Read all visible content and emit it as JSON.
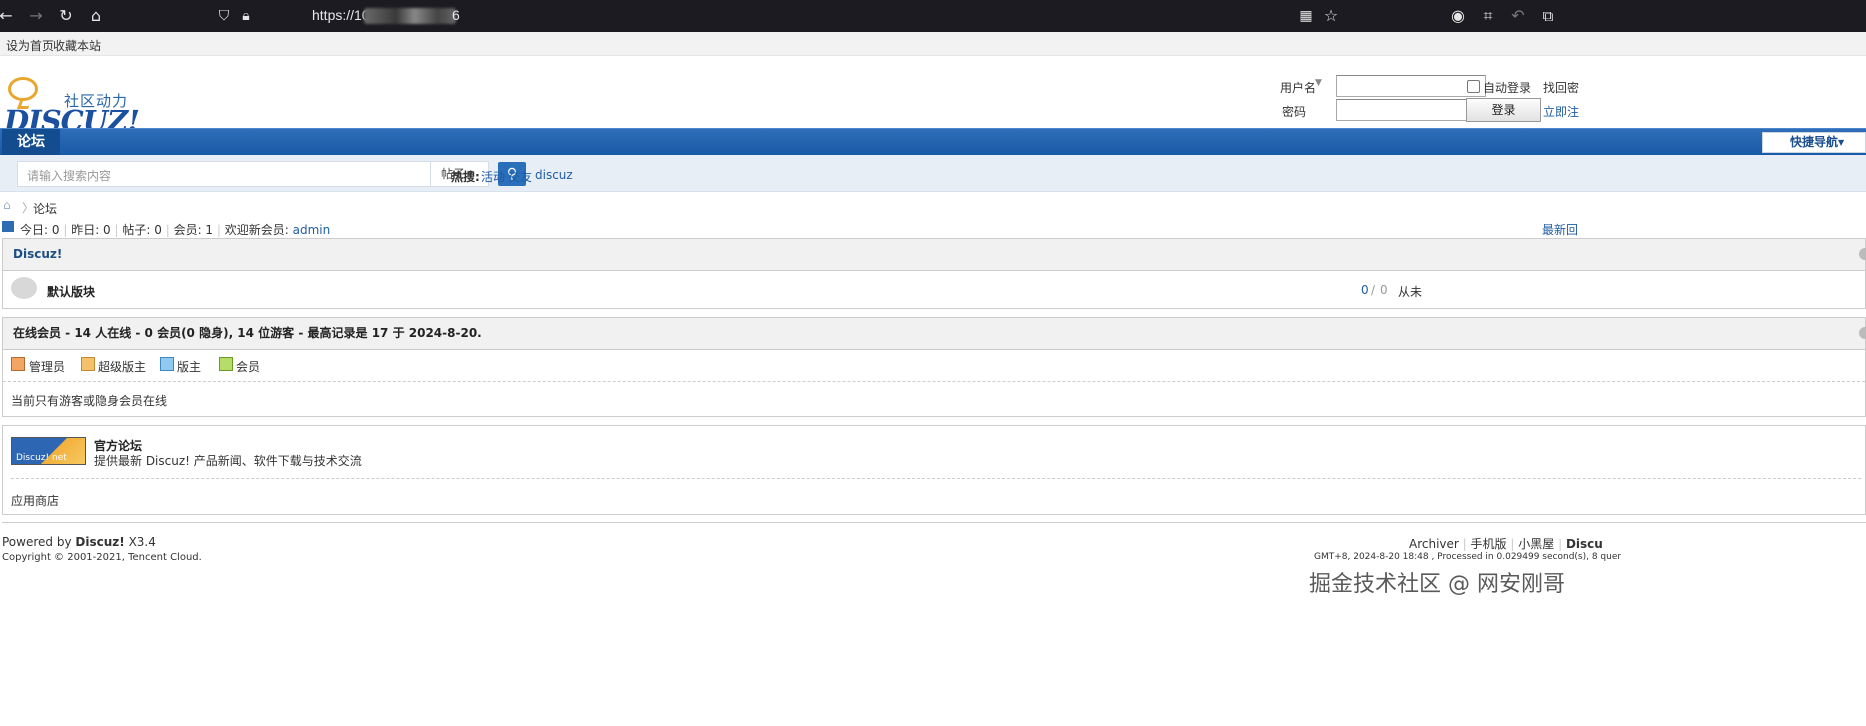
{
  "browser": {
    "url_prefix": "https://101",
    "url_suffix": "6",
    "icons": [
      "back-icon",
      "forward-icon",
      "reload-icon",
      "home-icon",
      "shield-icon",
      "lock-icon",
      "qr-icon",
      "star-icon",
      "account-icon",
      "crop-icon",
      "undo-icon",
      "extensions-icon"
    ]
  },
  "topnav": {
    "set_home": "设为首页",
    "bookmark": "收藏本站"
  },
  "logo": {
    "sub": "社区动力",
    "main": "DISCUZ!"
  },
  "login": {
    "username_label": "用户名",
    "password_label": "密码",
    "auto_login": "自动登录",
    "find_password": "找回密",
    "register": "立即注",
    "login_button": "登录"
  },
  "nav": {
    "forum_tab": "论坛",
    "quick_nav": "快捷导航"
  },
  "search": {
    "placeholder": "请输入搜索内容",
    "type": "帖子",
    "hot_label": "热搜:",
    "hot_terms": [
      "活动",
      "交友",
      "discuz"
    ]
  },
  "breadcrumb": {
    "current": "论坛"
  },
  "stats": {
    "today": "今日: 0",
    "yesterday": "昨日: 0",
    "posts": "帖子: 0",
    "members": "会员: 1",
    "welcome": "欢迎新会员:",
    "new_member": "admin",
    "latest": "最新回"
  },
  "forum_category": {
    "title": "Discuz!",
    "forums": [
      {
        "name": "默认版块",
        "threads": "0",
        "sep": "/",
        "posts": "0",
        "last": "从未"
      }
    ]
  },
  "online": {
    "title": "在线会员 - 14 人在线 - 0 会员(0 隐身), 14 位游客 - 最高记录是 17 于 2024-8-20.",
    "legend": [
      "管理员",
      "超级版主",
      "版主",
      "会员"
    ],
    "note": "当前只有游客或隐身会员在线"
  },
  "links": {
    "official_title": "官方论坛",
    "official_desc": "提供最新 Discuz! 产品新闻、软件下载与技术交流",
    "official_logo": "Discuz! net",
    "app_store": "应用商店"
  },
  "footer": {
    "powered_prefix": "Powered by",
    "powered_brand": "Discuz!",
    "version": "X3.4",
    "copyright": "Copyright © 2001-2021, Tencent Cloud.",
    "links": [
      "Archiver",
      "手机版",
      "小黑屋",
      "Discu"
    ],
    "stats": "GMT+8, 2024-8-20 18:48 , Processed in 0.029499 second(s), 8 quer"
  },
  "watermark": "掘金技术社区 @ 网安刚哥"
}
